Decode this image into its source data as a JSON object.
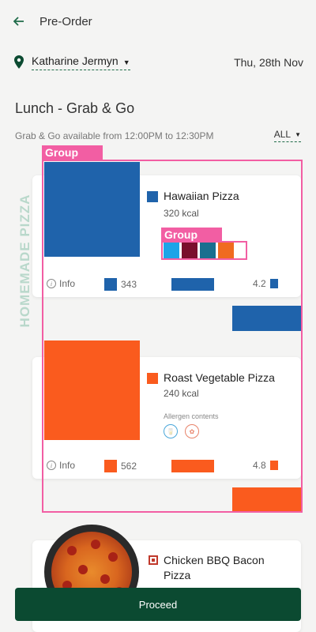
{
  "header": {
    "title": "Pre-Order",
    "back_icon": "arrow-left-icon"
  },
  "location": {
    "name": "Katharine Jermyn",
    "date": "Thu, 28th Nov",
    "pin_icon": "location-pin-icon"
  },
  "section": {
    "title": "Lunch - Grab & Go",
    "availability": "Grab & Go available from 12:00PM to 12:30PM",
    "filter": "ALL"
  },
  "category_label": "HOMEMADE PIZZA",
  "overlay": {
    "group_label_1": "Group",
    "group_label_2": "Group"
  },
  "dishes": [
    {
      "name": "Hawaiian Pizza",
      "kcal": "320 kcal",
      "info": "Info",
      "stat1": "343",
      "rating": "4.2",
      "accent": "#1f63ab",
      "allergen_colors": [
        "#1da4e8",
        "#7a0f2c",
        "#1a6f8f",
        "#f06b20"
      ]
    },
    {
      "name": "Roast Vegetable Pizza",
      "kcal": "240 kcal",
      "allergen_label": "Allergen contents",
      "info": "Info",
      "stat1": "562",
      "rating": "4.8",
      "accent": "#fa5b1e"
    },
    {
      "name": "Chicken BBQ Bacon Pizza"
    }
  ],
  "proceed_label": "Proceed",
  "colors": {
    "brand": "#0b4a31",
    "overlay": "#f25ea3",
    "blue": "#1f63ab",
    "orange": "#fa5b1e"
  }
}
